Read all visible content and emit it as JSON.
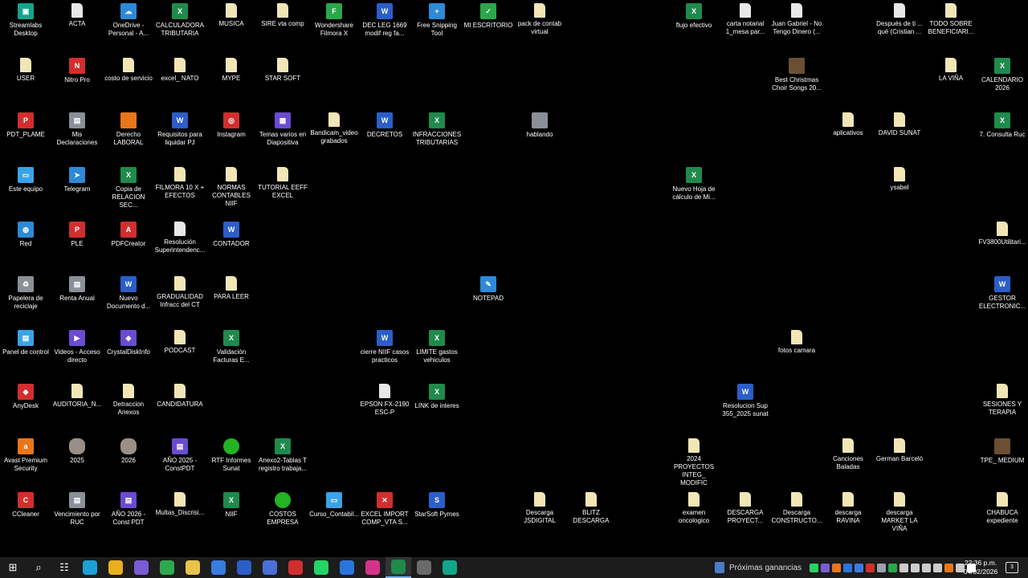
{
  "desktop_icons": [
    {
      "label": "Streamlabs Desktop",
      "icon": "streamlabs-icon",
      "kind": "teal",
      "glyph": "▣"
    },
    {
      "label": "ACTA",
      "icon": "document-icon",
      "kind": "doc",
      "glyph": ""
    },
    {
      "label": "OneDrive - Personal - A...",
      "icon": "onedrive-icon",
      "kind": "blue",
      "glyph": "☁"
    },
    {
      "label": "CALCULADORA TRIBUTARIA",
      "icon": "excel-file-icon",
      "kind": "excel",
      "glyph": "X"
    },
    {
      "label": "MUSICA",
      "icon": "folder-icon",
      "kind": "file",
      "glyph": ""
    },
    {
      "label": "SIRE vta comp",
      "icon": "folder-icon",
      "kind": "file",
      "glyph": ""
    },
    {
      "label": "Wondershare Filmora X",
      "icon": "filmora-icon",
      "kind": "green",
      "glyph": "F"
    },
    {
      "label": "DEC LEG 1669 modif reg fa...",
      "icon": "word-file-icon",
      "kind": "word",
      "glyph": "W"
    },
    {
      "label": "Free Snipping Tool",
      "icon": "snipping-tool-icon",
      "kind": "blue",
      "glyph": "+"
    },
    {
      "label": "MI ESCRITORIO",
      "icon": "checkmark-icon",
      "kind": "green",
      "glyph": "✓"
    },
    {
      "label": "pack de contab virtual",
      "icon": "folder-icon",
      "kind": "file",
      "glyph": ""
    },
    {
      "label": "flujo efectivo",
      "icon": "excel-file-icon",
      "kind": "excel",
      "glyph": "X"
    },
    {
      "label": "carta notarial 1_mesa par...",
      "icon": "document-icon",
      "kind": "doc",
      "glyph": ""
    },
    {
      "label": "Juan Gabriel - No Tengo Dinero (...",
      "icon": "audio-file-icon",
      "kind": "doc",
      "glyph": ""
    },
    {
      "label": "Después de ti ... qué (Cristian ...",
      "icon": "audio-file-icon",
      "kind": "doc",
      "glyph": ""
    },
    {
      "label": "TODO SOBRE BENEFICIARI...",
      "icon": "folder-icon",
      "kind": "file",
      "glyph": ""
    },
    {
      "label": "USER",
      "icon": "user-folder-icon",
      "kind": "file",
      "glyph": ""
    },
    {
      "label": "Nitro Pro",
      "icon": "nitro-pro-icon",
      "kind": "red",
      "glyph": "N"
    },
    {
      "label": "costo de servicio",
      "icon": "folder-icon",
      "kind": "file",
      "glyph": ""
    },
    {
      "label": "excel_ NATO",
      "icon": "folder-icon",
      "kind": "file",
      "glyph": ""
    },
    {
      "label": "MYPE",
      "icon": "folder-icon",
      "kind": "file",
      "glyph": ""
    },
    {
      "label": "STAR SOFT",
      "icon": "folder-icon",
      "kind": "file",
      "glyph": ""
    },
    {
      "label": "Best Christmas Choir Songs 20...",
      "icon": "video-file-icon",
      "kind": "photo",
      "glyph": ""
    },
    {
      "label": "LA VIÑA",
      "icon": "folder-icon",
      "kind": "file",
      "glyph": ""
    },
    {
      "label": "CALENDARIO 2026",
      "icon": "excel-file-icon",
      "kind": "excel",
      "glyph": "X"
    },
    {
      "label": "PDT_PLAME",
      "icon": "pdt-plame-icon",
      "kind": "red",
      "glyph": "P"
    },
    {
      "label": "Mis Declaraciones",
      "icon": "declaraciones-icon",
      "kind": "gray",
      "glyph": "▤"
    },
    {
      "label": "Derecho LABORAL",
      "icon": "folder-icon",
      "kind": "orange",
      "glyph": ""
    },
    {
      "label": "Requisitos para liquidar PJ",
      "icon": "word-file-icon",
      "kind": "word",
      "glyph": "W"
    },
    {
      "label": "Instagram",
      "icon": "instagram-icon",
      "kind": "red",
      "glyph": "◎"
    },
    {
      "label": "Temas varios en Diapositiva",
      "icon": "presentation-icon",
      "kind": "app",
      "glyph": "▦"
    },
    {
      "label": "Bandicam_video grabados",
      "icon": "folder-icon",
      "kind": "file",
      "glyph": ""
    },
    {
      "label": "DECRETOS",
      "icon": "word-file-icon",
      "kind": "word",
      "glyph": "W"
    },
    {
      "label": "INFRACCIONES TRIBUTARIAS",
      "icon": "excel-file-icon",
      "kind": "excel",
      "glyph": "X"
    },
    {
      "label": "hablando",
      "icon": "image-file-icon",
      "kind": "gray",
      "glyph": ""
    },
    {
      "label": "aplicativos",
      "icon": "folder-icon",
      "kind": "file",
      "glyph": ""
    },
    {
      "label": "DAVID SUNAT",
      "icon": "folder-icon",
      "kind": "file",
      "glyph": ""
    },
    {
      "label": "7. Consulta Ruc",
      "icon": "excel-file-icon",
      "kind": "excel",
      "glyph": "X"
    },
    {
      "label": "Este equipo",
      "icon": "computer-icon",
      "kind": "pc",
      "glyph": "▭"
    },
    {
      "label": "Telegram",
      "icon": "telegram-icon",
      "kind": "blue",
      "glyph": "➤"
    },
    {
      "label": "Copia de RELACION SEC...",
      "icon": "excel-file-icon",
      "kind": "excel",
      "glyph": "X"
    },
    {
      "label": "FILMORA 10 X + EFECTOS",
      "icon": "folder-icon",
      "kind": "file",
      "glyph": ""
    },
    {
      "label": "NORMAS CONTABLES NIIF",
      "icon": "folder-icon",
      "kind": "file",
      "glyph": ""
    },
    {
      "label": "TUTORIAL EEFF EXCEL",
      "icon": "folder-icon",
      "kind": "file",
      "glyph": ""
    },
    {
      "label": "Nuevo Hoja de cálculo de Mi...",
      "icon": "excel-file-icon",
      "kind": "excel",
      "glyph": "X"
    },
    {
      "label": "ysabel",
      "icon": "folder-icon",
      "kind": "file",
      "glyph": ""
    },
    {
      "label": "Red",
      "icon": "network-icon",
      "kind": "blue",
      "glyph": "◍"
    },
    {
      "label": "PLE",
      "icon": "ple-icon",
      "kind": "red",
      "glyph": "P"
    },
    {
      "label": "PDFCreator",
      "icon": "pdfcreator-icon",
      "kind": "red",
      "glyph": "A"
    },
    {
      "label": "Resolución Superintendenc...",
      "icon": "document-icon",
      "kind": "doc",
      "glyph": ""
    },
    {
      "label": "CONTADOR",
      "icon": "word-file-icon",
      "kind": "word",
      "glyph": "W"
    },
    {
      "label": "FV3800Utilitari...",
      "icon": "folder-icon",
      "kind": "file",
      "glyph": ""
    },
    {
      "label": "Papelera de reciclaje",
      "icon": "recycle-bin-icon",
      "kind": "gray",
      "glyph": "♻"
    },
    {
      "label": "Renta Anual",
      "icon": "renta-anual-icon",
      "kind": "gray",
      "glyph": "▤"
    },
    {
      "label": "Nuevo Documento d...",
      "icon": "word-file-icon",
      "kind": "word",
      "glyph": "W"
    },
    {
      "label": "GRADUALIDAD Infracc del CT",
      "icon": "folder-icon",
      "kind": "file",
      "glyph": ""
    },
    {
      "label": "PARA LEER",
      "icon": "folder-icon",
      "kind": "file",
      "glyph": ""
    },
    {
      "label": "NOTEPAD",
      "icon": "notepad-icon",
      "kind": "blue",
      "glyph": "✎"
    },
    {
      "label": "GESTOR ELECTRONIC...",
      "icon": "word-file-icon",
      "kind": "word",
      "glyph": "W"
    },
    {
      "label": "Panel de control",
      "icon": "control-panel-icon",
      "kind": "pc",
      "glyph": "▤"
    },
    {
      "label": "Videos - Acceso directo",
      "icon": "videos-shortcut-icon",
      "kind": "app",
      "glyph": "▶"
    },
    {
      "label": "CrystalDiskInfo",
      "icon": "crystaldiskinfo-icon",
      "kind": "app",
      "glyph": "◆"
    },
    {
      "label": "PODCAST",
      "icon": "folder-icon",
      "kind": "file",
      "glyph": ""
    },
    {
      "label": "Validación Facturas E...",
      "icon": "excel-file-icon",
      "kind": "excel",
      "glyph": "X"
    },
    {
      "label": "cierre NIIF casos practicos",
      "icon": "word-file-icon",
      "kind": "word",
      "glyph": "W"
    },
    {
      "label": "LIMITE gastos vehiculos",
      "icon": "excel-file-icon",
      "kind": "excel",
      "glyph": "X"
    },
    {
      "label": "fotos camara",
      "icon": "folder-icon",
      "kind": "file",
      "glyph": ""
    },
    {
      "label": "AnyDesk",
      "icon": "anydesk-icon",
      "kind": "red",
      "glyph": "◆"
    },
    {
      "label": "AUDITORIA_N...",
      "icon": "folder-icon",
      "kind": "file",
      "glyph": ""
    },
    {
      "label": "Detraccion Anexos",
      "icon": "folder-icon",
      "kind": "file",
      "glyph": ""
    },
    {
      "label": "CANDIDATURA",
      "icon": "folder-icon",
      "kind": "file",
      "glyph": ""
    },
    {
      "label": "EPSON FX-2190 ESC-P",
      "icon": "document-icon",
      "kind": "doc",
      "glyph": ""
    },
    {
      "label": "LINK de interes",
      "icon": "excel-file-icon",
      "kind": "excel",
      "glyph": "X"
    },
    {
      "label": "Resolucion Sup 355_2025 sunat",
      "icon": "word-file-icon",
      "kind": "word",
      "glyph": "W"
    },
    {
      "label": "SESIONES Y TERAPIA",
      "icon": "folder-icon",
      "kind": "file",
      "glyph": ""
    },
    {
      "label": "Avast Premium Security",
      "icon": "avast-icon",
      "kind": "orange",
      "glyph": "a"
    },
    {
      "label": "2025",
      "icon": "user-group-icon",
      "kind": "people",
      "glyph": ""
    },
    {
      "label": "2026",
      "icon": "user-group-icon",
      "kind": "people",
      "glyph": ""
    },
    {
      "label": "AÑO 2025 - ConstPDT",
      "icon": "pdt-app-icon",
      "kind": "app",
      "glyph": "▤"
    },
    {
      "label": "RTF Informes Sunat",
      "icon": "tree-icon",
      "kind": "tree",
      "glyph": ""
    },
    {
      "label": "Anexo2-Tablas T registro trabaja...",
      "icon": "excel-file-icon",
      "kind": "excel",
      "glyph": "X"
    },
    {
      "label": "2024 PROYECTOS INTEG_ MODIFIC",
      "icon": "folder-icon",
      "kind": "file",
      "glyph": ""
    },
    {
      "label": "Canciones Baladas",
      "icon": "folder-icon",
      "kind": "file",
      "glyph": ""
    },
    {
      "label": "German Barceló",
      "icon": "folder-icon",
      "kind": "file",
      "glyph": ""
    },
    {
      "label": "TPE_ MEDIUM",
      "icon": "image-file-icon",
      "kind": "photo",
      "glyph": ""
    },
    {
      "label": "CCleaner",
      "icon": "ccleaner-icon",
      "kind": "red",
      "glyph": "C"
    },
    {
      "label": "Vencimiento por RUC",
      "icon": "network-shortcut-icon",
      "kind": "gray",
      "glyph": "▤"
    },
    {
      "label": "AÑO 2026 - Const PDT",
      "icon": "pdt-app-icon",
      "kind": "app",
      "glyph": "▤"
    },
    {
      "label": "Multas_Discrisi...",
      "icon": "folder-icon",
      "kind": "file",
      "glyph": ""
    },
    {
      "label": "NIIF",
      "icon": "excel-file-icon",
      "kind": "excel",
      "glyph": "X"
    },
    {
      "label": "COSTOS EMPRESA",
      "icon": "tree-icon",
      "kind": "tree",
      "glyph": ""
    },
    {
      "label": "Curso_Contabil...",
      "icon": "course-file-icon",
      "kind": "pc",
      "glyph": "▭"
    },
    {
      "label": "EXCEL IMPORT COMP_VTA S...",
      "icon": "excel-import-icon",
      "kind": "red",
      "glyph": "✕"
    },
    {
      "label": "StarSoft Pymes",
      "icon": "starsoft-icon",
      "kind": "word",
      "glyph": "S"
    },
    {
      "label": "Descarga JSDIGITAL",
      "icon": "folder-icon",
      "kind": "file",
      "glyph": ""
    },
    {
      "label": "BLITZ DESCARGA",
      "icon": "folder-icon",
      "kind": "file",
      "glyph": ""
    },
    {
      "label": "examen oncologico",
      "icon": "folder-icon",
      "kind": "file",
      "glyph": ""
    },
    {
      "label": "DESCARGA PROYECT...",
      "icon": "folder-icon",
      "kind": "file",
      "glyph": ""
    },
    {
      "label": "Descarga CONSTRUCTO...",
      "icon": "folder-icon",
      "kind": "file",
      "glyph": ""
    },
    {
      "label": "descarga RAVINA",
      "icon": "folder-icon",
      "kind": "file",
      "glyph": ""
    },
    {
      "label": "descarga MARKET LA VIÑA",
      "icon": "folder-icon",
      "kind": "file",
      "glyph": ""
    },
    {
      "label": "CHABUCA expediente",
      "icon": "folder-icon",
      "kind": "file",
      "glyph": ""
    }
  ],
  "taskbar": {
    "start_glyph": "⊞",
    "search_glyph": "⌕",
    "taskview_glyph": "☷",
    "apps": [
      {
        "name": "edge-icon",
        "color": "#1aa1d6"
      },
      {
        "name": "chrome-icon",
        "color": "#e8b11c"
      },
      {
        "name": "copilot-icon",
        "color": "#7a5bd6"
      },
      {
        "name": "chrome-profile-icon",
        "color": "#2fa84f"
      },
      {
        "name": "file-explorer-icon",
        "color": "#e8c24a"
      },
      {
        "name": "microsoft-store-icon",
        "color": "#3a7be0"
      },
      {
        "name": "starsoft-icon",
        "color": "#2b5ec8"
      },
      {
        "name": "photos-icon",
        "color": "#4b6fd6"
      },
      {
        "name": "anydesk-icon",
        "color": "#d22e2e"
      },
      {
        "name": "whatsapp-icon",
        "color": "#25d366"
      },
      {
        "name": "snipping-tool-icon",
        "color": "#2b74e0"
      },
      {
        "name": "instagram-icon",
        "color": "#d6338a"
      },
      {
        "name": "excel-icon",
        "color": "#1f8a4c"
      },
      {
        "name": "media-player-icon",
        "color": "#6a6a6a"
      },
      {
        "name": "streamlabs-icon",
        "color": "#13a58a"
      }
    ],
    "active_app_index": 12,
    "news_label": "Próximas ganancias",
    "tray": [
      {
        "name": "whatsapp-tray-icon",
        "color": "#25d366"
      },
      {
        "name": "copilot-tray-icon",
        "color": "#7a5bd6"
      },
      {
        "name": "avast-tray-icon",
        "color": "#e8761c"
      },
      {
        "name": "meet-tray-icon",
        "color": "#2b74e0"
      },
      {
        "name": "vpn-tray-icon",
        "color": "#3a7be0"
      },
      {
        "name": "anydesk-tray-icon",
        "color": "#d22e2e"
      },
      {
        "name": "onedrive-tray-icon",
        "color": "#9aa3ad"
      },
      {
        "name": "security-tray-icon",
        "color": "#29a74a"
      },
      {
        "name": "mic-tray-icon",
        "color": "#cccccc"
      },
      {
        "name": "network-tray-icon",
        "color": "#cccccc"
      },
      {
        "name": "volume-tray-icon",
        "color": "#cccccc"
      },
      {
        "name": "battery-tray-icon",
        "color": "#cccccc"
      },
      {
        "name": "avast-alert-tray-icon",
        "color": "#e8761c"
      },
      {
        "name": "printer-tray-icon",
        "color": "#cccccc"
      },
      {
        "name": "plus-tray-icon",
        "color": "#ffffff"
      }
    ],
    "time": "22:36 p.m.",
    "date": "04/02/2026",
    "notification_count": "3"
  }
}
